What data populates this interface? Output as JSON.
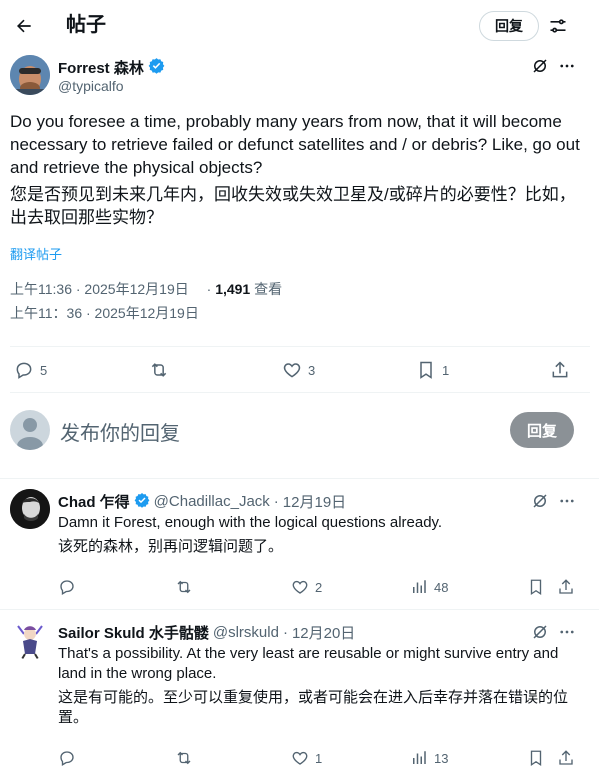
{
  "header": {
    "title": "帖子",
    "reply_button": "回复"
  },
  "post": {
    "author_name": "Forrest 森林",
    "author_handle": "@typicalfo",
    "text_en": "Do you foresee a time, probably many years from now, that it will become necessary to retrieve failed or defunct satellites and / or debris? Like, go out and retrieve the physical objects?",
    "text_zh": "您是否预见到未来几年内，回收失效或失效卫星及/或碎片的必要性？比如，出去取回那些实物？",
    "translate_link": "翻译帖子",
    "timestamp": "上午11:36 · 2025年12月19日",
    "views_sep": "·",
    "views_count": "1,491",
    "views_label": "查看",
    "timestamp_zh": "上午11：36 · 2025年12月19日",
    "stats": {
      "replies": "5",
      "reposts": "",
      "likes": "3",
      "bookmarks": "1"
    }
  },
  "compose": {
    "placeholder": "发布你的回复",
    "reply_button": "回复"
  },
  "replies": [
    {
      "name": "Chad 乍得",
      "handle": "@Chadillac_Jack",
      "sep": "·",
      "date": "12月19日",
      "text_en": "Damn it Forest, enough with the logical questions already.",
      "text_zh": "该死的森林，别再问逻辑问题了。",
      "likes": "2",
      "views": "48"
    },
    {
      "name": "Sailor Skuld 水手骷髅",
      "handle": "@slrskuld",
      "sep": "·",
      "date": "12月20日",
      "text_en": "That's a possibility. At the very least are reusable or might survive entry and land in the wrong place.",
      "text_zh": "这是有可能的。至少可以重复使用，或者可能会在进入后幸存并落在错误的位置。",
      "likes": "1",
      "views": "13"
    }
  ],
  "colors": {
    "verified": "#1d9bf0",
    "link": "#1d9bf0",
    "muted": "#536471",
    "disabled_button": "#8b9196"
  },
  "icons": [
    "back-arrow-icon",
    "tune-icon",
    "verified-badge-icon",
    "grok-icon",
    "more-icon",
    "reply-icon",
    "repost-icon",
    "like-icon",
    "views-icon",
    "bookmark-icon",
    "share-icon"
  ]
}
